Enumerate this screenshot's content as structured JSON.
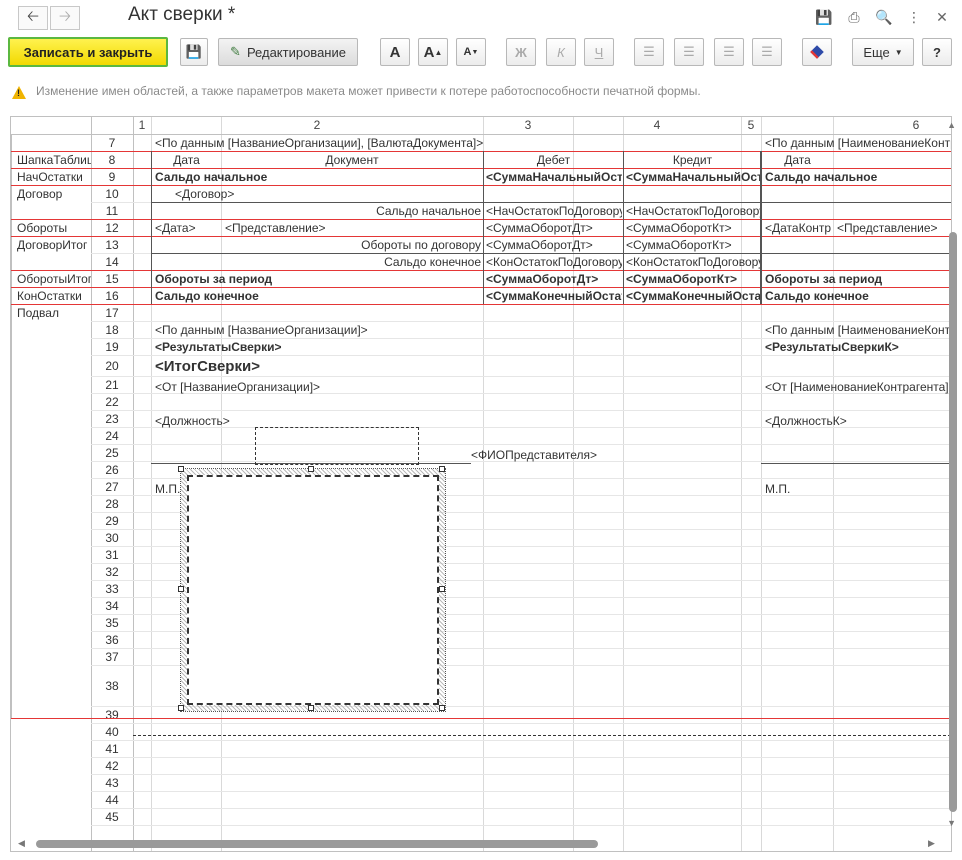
{
  "window": {
    "title": "Акт сверки *",
    "back_icon": "arrow-left-icon",
    "forward_icon": "arrow-right-icon"
  },
  "toolbar": {
    "save_close": "Записать и закрыть",
    "edit_mode": "Редактирование",
    "bold_a": "A",
    "grow_a": "A",
    "shrink_a": "A",
    "bold_label": "Ж",
    "italic_label": "К",
    "underline_label": "Ч",
    "more": "Еще",
    "help": "?"
  },
  "warning": "Изменение имен областей, а также параметров макета может привести к потере работоспособности печатной формы.",
  "sheet": {
    "col_headers": [
      "1",
      "2",
      "3",
      "4",
      "5",
      "6"
    ],
    "row_numbers": [
      "7",
      "8",
      "9",
      "10",
      "11",
      "12",
      "13",
      "14",
      "15",
      "16",
      "17",
      "18",
      "19",
      "20",
      "21",
      "22",
      "23",
      "24",
      "25",
      "26",
      "27",
      "28",
      "29",
      "30",
      "31",
      "32",
      "33",
      "34",
      "35",
      "36",
      "37",
      "38",
      "39",
      "40",
      "41",
      "42",
      "43",
      "44",
      "45"
    ],
    "areas": [
      "ШапкаТаблицы",
      "НачОстатки",
      "Договор",
      "Обороты",
      "ДоговорИтог",
      "ОборотыИтог",
      "КонОстатки",
      "Подвал"
    ],
    "cells": {
      "r7_left": "<По данным [НазваниеОрганизации],  [ВалютаДокумента]>",
      "r7_right": "<По данным [НаименованиеКонтрагента]",
      "r8_date": "Дата",
      "r8_doc": "Документ",
      "r8_debit": "Дебет",
      "r8_credit": "Кредит",
      "r8_date2": "Дата",
      "r9_label": "Сальдо начальное",
      "r9_debit": "<СуммаНачальныйОстатокДт>",
      "r9_credit": "<СуммаНачальныйОстатокКт>",
      "r9_label2": "Сальдо начальное",
      "r10_contract": "<Договор>",
      "r11_label": "Сальдо начальное",
      "r11_debit": "<НачОстатокПоДоговоруДт>",
      "r11_credit": "<НачОстатокПоДоговоруКт>",
      "r12_date": "<Дата>",
      "r12_repr": "<Представление>",
      "r12_debit": "<СуммаОборотДт>",
      "r12_credit": "<СуммаОборотКт>",
      "r12_date2": "<ДатаКонтрагента>",
      "r12_repr2": "<Представление>",
      "r13_label": "Обороты по договору",
      "r13_debit": "<СуммаОборотДт>",
      "r13_credit": "<СуммаОборотКт>",
      "r14_label": "Сальдо конечное",
      "r14_debit": "<КонОстатокПоДоговоруДт>",
      "r14_credit": "<КонОстатокПоДоговоруКт>",
      "r15_label": "Обороты за период",
      "r15_debit": "<СуммаОборотДт>",
      "r15_credit": "<СуммаОборотКт>",
      "r15_label2": "Обороты за период",
      "r16_label": "Сальдо конечное",
      "r16_debit": "<СуммаКонечныйОстатокДт>",
      "r16_credit": "<СуммаКонечныйОстатокКт>",
      "r16_label2": "Сальдо конечное",
      "r18_left": "<По данным [НазваниеОрганизации]>",
      "r18_right": "<По данным [НаименованиеКонтрагента]>",
      "r19_left": "<РезультатыСверки>",
      "r19_right": "<РезультатыСверкиК>",
      "r20": "<ИтогСверки>",
      "r21_left": "<От [НазваниеОрганизации]>",
      "r21_right": "<От [НаименованиеКонтрагента]>",
      "r23_left": "<Должность>",
      "r23_right": "<ДолжностьК>",
      "r25_fio": "<ФИОПредставителя>",
      "r27_left": "М.П.",
      "r27_right": "М.П."
    }
  }
}
